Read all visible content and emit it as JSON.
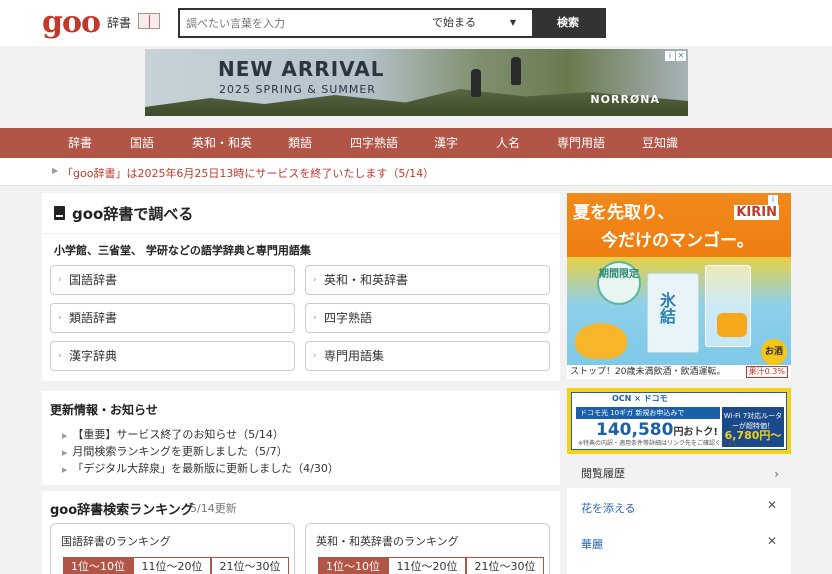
{
  "header": {
    "logo": "goo",
    "logo_sub": "辞書",
    "search_placeholder": "調べたい言葉を入力",
    "search_mode": "で始まる",
    "search_button": "検索"
  },
  "banner_ad": {
    "headline": "NEW ARRIVAL",
    "subline": "2025 SPRING & SUMMER",
    "brand": "NORRØNA"
  },
  "nav": {
    "items": [
      "辞書",
      "国語",
      "英和・和英",
      "類語",
      "四字熟語",
      "漢字",
      "人名",
      "専門用語",
      "豆知識"
    ]
  },
  "notice": {
    "text": "「goo辞書」は2025年6月25日13時にサービスを終了いたします（5/14）"
  },
  "search_panel": {
    "title": "goo辞書で調べる",
    "subtitle": "小学館、三省堂、 学研などの語学辞典と専門用語集",
    "dictionaries": [
      "国語辞書",
      "英和・和英辞書",
      "類語辞書",
      "四字熟語",
      "漢字辞典",
      "専門用語集"
    ]
  },
  "news": {
    "title": "更新情報・お知らせ",
    "items": [
      "【重要】サービス終了のお知らせ（5/14）",
      "月間検索ランキングを更新しました（5/7）",
      "「デジタル大辞泉」を最新版に更新しました（4/30）"
    ]
  },
  "ranking": {
    "title": "goo辞書検索ランキング",
    "updated": "5/14更新",
    "cards": [
      {
        "title": "国語辞書のランキング",
        "tabs": [
          "1位〜10位",
          "11位〜20位",
          "21位〜30位"
        ]
      },
      {
        "title": "英和・和英辞書のランキング",
        "tabs": [
          "1位〜10位",
          "11位〜20位",
          "21位〜30位"
        ]
      }
    ]
  },
  "kirin_ad": {
    "line1": "夏を先取り、",
    "line2": "今だけのマンゴー。",
    "brand": "KIRIN",
    "badge": "期間限定",
    "can_text": "氷結",
    "osake": "お酒",
    "footer": "ストップ！20歳未満飲酒・飲酒運転。",
    "percent": "果汁0.3%"
  },
  "ocn_ad": {
    "top": "OCN × ドコモ",
    "blue_text": "ドコモ光 10ギガ 新規お申込みで",
    "price": "140,580",
    "price_suffix": "円おトク!",
    "right_top": "Wi-Fi 7対応ルーターが超特価！",
    "right_price": "6,780円〜",
    "note": "※特典の内訳・適用条件等詳細はリンク先をご確認ください"
  },
  "history": {
    "title": "閲覧履歴",
    "items": [
      "花を添える",
      "華麗"
    ]
  },
  "colors": {
    "nav_bg": "#b15546",
    "accent_red": "#c0392b",
    "link_blue": "#2a68b5"
  }
}
